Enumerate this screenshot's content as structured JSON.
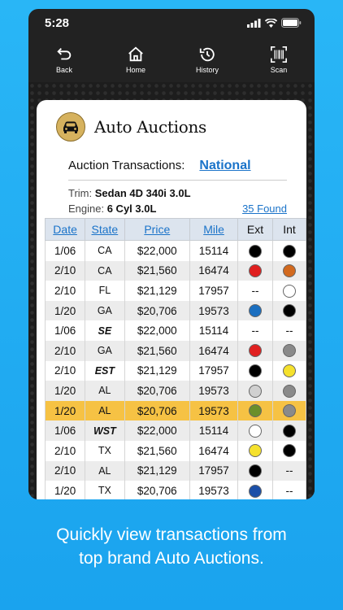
{
  "status": {
    "time": "5:28"
  },
  "nav": [
    {
      "label": "Back",
      "icon": "back-arrow-icon"
    },
    {
      "label": "Home",
      "icon": "home-icon"
    },
    {
      "label": "History",
      "icon": "history-icon"
    },
    {
      "label": "Scan",
      "icon": "barcode-scan-icon"
    }
  ],
  "header": {
    "title": "Auto Auctions",
    "logo_icon": "car-icon"
  },
  "transactions": {
    "label": "Auction Transactions:",
    "scope": "National"
  },
  "vehicle": {
    "trim_label": "Trim:",
    "trim": "Sedan 4D 340i 3.0L",
    "engine_label": "Engine:",
    "engine": "6 Cyl 3.0L",
    "found": "35 Found"
  },
  "table": {
    "headers": [
      "Date",
      "State",
      "Price",
      "Mile",
      "Ext",
      "Int"
    ],
    "rows": [
      {
        "date": "1/06",
        "state": "CA",
        "price": "$22,000",
        "mile": "15114",
        "ext": "#000000",
        "int": "#000000"
      },
      {
        "date": "2/10",
        "state": "CA",
        "price": "$21,560",
        "mile": "16474",
        "ext": "#e02020",
        "int": "#d2691e"
      },
      {
        "date": "2/10",
        "state": "FL",
        "price": "$21,129",
        "mile": "17957",
        "ext": "--",
        "int": "#ffffff"
      },
      {
        "date": "1/20",
        "state": "GA",
        "price": "$20,706",
        "mile": "19573",
        "ext": "#1b6fc0",
        "int": "#000000"
      },
      {
        "date": "1/06",
        "state": "SE",
        "price": "$22,000",
        "mile": "15114",
        "ext": "--",
        "int": "--"
      },
      {
        "date": "2/10",
        "state": "GA",
        "price": "$21,560",
        "mile": "16474",
        "ext": "#e02020",
        "int": "#8a8a8a"
      },
      {
        "date": "2/10",
        "state": "EST",
        "price": "$21,129",
        "mile": "17957",
        "ext": "#000000",
        "int": "#f5e12d"
      },
      {
        "date": "1/20",
        "state": "AL",
        "price": "$20,706",
        "mile": "19573",
        "ext": "#d0d0d0",
        "int": "#8a8a8a"
      },
      {
        "date": "1/20",
        "state": "AL",
        "price": "$20,706",
        "mile": "19573",
        "ext": "#6b8f2a",
        "int": "#8a8a8a",
        "highlight": true
      },
      {
        "date": "1/06",
        "state": "WST",
        "price": "$22,000",
        "mile": "15114",
        "ext": "#ffffff",
        "int": "#000000"
      },
      {
        "date": "2/10",
        "state": "TX",
        "price": "$21,560",
        "mile": "16474",
        "ext": "#f5e12d",
        "int": "#000000"
      },
      {
        "date": "2/10",
        "state": "AL",
        "price": "$21,129",
        "mile": "17957",
        "ext": "#000000",
        "int": "--"
      },
      {
        "date": "1/20",
        "state": "TX",
        "price": "$20,706",
        "mile": "19573",
        "ext": "#1b4fa8",
        "int": "--"
      }
    ]
  },
  "regions": [
    "SE",
    "EST",
    "WST"
  ],
  "caption": {
    "line1": "Quickly view transactions from",
    "line2": "top brand Auto Auctions."
  }
}
